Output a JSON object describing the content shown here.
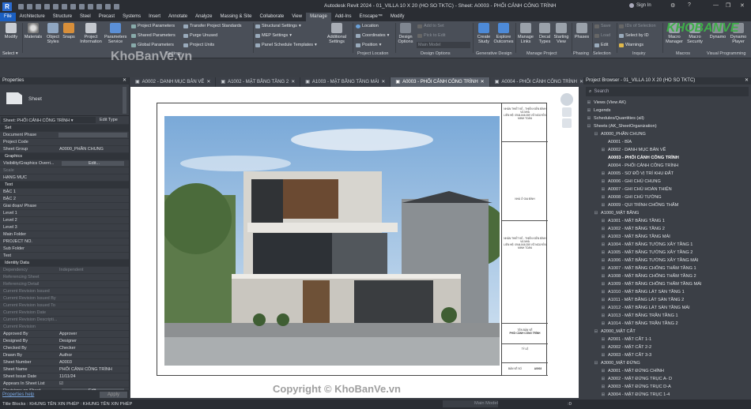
{
  "title": "Autodesk Revit 2024 - 01_VILLA 10 X 20 (HO SO TKTC) - Sheet: A0003 - PHỐI CẢNH CÔNG TRÌNH",
  "sign_in": "Sign In",
  "menu_tabs": [
    "File",
    "Architecture",
    "Structure",
    "Steel",
    "Precast",
    "Systems",
    "Insert",
    "Annotate",
    "Analyze",
    "Massing & Site",
    "Collaborate",
    "View",
    "Manage",
    "Add-Ins",
    "Enscape™",
    "Modify"
  ],
  "ribbon": {
    "modify": "Modify",
    "materials": "Materials",
    "object_styles": "Object Styles",
    "snaps": "Snaps",
    "project_information": "Project Information",
    "parameters_service": "Parameters Service",
    "project_parameters": "Project Parameters",
    "shared_parameters": "Shared Parameters",
    "global_parameters": "Global Parameters",
    "transfer_project_standards": "Transfer Project Standards",
    "purge_unused": "Purge Unused",
    "project_units": "Project Units",
    "structural_settings": "Structural Settings",
    "mep_settings": "MEP Settings",
    "panel_schedule_templates": "Panel Schedule Templates",
    "additional_settings": "Additional Settings",
    "location": "Location",
    "coordinates": "Coordinates",
    "position": "Position",
    "design_options": "Design Options",
    "add_to_set": "Add to Set",
    "pick_to_edit": "Pick to Edit",
    "main_model": "Main Model",
    "create_study": "Create Study",
    "explore_outcomes": "Explore Outcomes",
    "manage_links": "Manage Links",
    "decal_types": "Decal Types",
    "starting_view": "Starting View",
    "phases": "Phases",
    "save": "Save",
    "load": "Load",
    "edit": "Edit",
    "ids_of_selection": "IDs of Selection",
    "select_by_id": "Select by ID",
    "warnings": "Warnings",
    "macro_manager": "Macro Manager",
    "macro_security": "Macro Security",
    "dynamo": "Dynamo",
    "dynamo_player": "Dynamo Player",
    "select_label": "Select ▾",
    "panels": [
      "Settings",
      "Project Location",
      "Design Options",
      "Generative Design",
      "Manage Project",
      "Phasing",
      "Selection",
      "Inquiry",
      "Macros",
      "Visual Programming"
    ]
  },
  "properties": {
    "header": "Properties",
    "type": "Sheet",
    "instance": "Sheet: PHỐI CẢNH CÔNG TRÌNH",
    "edit_type": "Edit Type",
    "rows": [
      {
        "k": "Set",
        "grp": true
      },
      {
        "k": "Document Phase",
        "v": "",
        "box": true
      },
      {
        "k": "Project Code",
        "v": ""
      },
      {
        "k": "Sheet Group",
        "v": "A0000_PHẦN CHUNG"
      },
      {
        "k": "Graphics",
        "grp": true
      },
      {
        "k": "Visibility/Graphics Overri...",
        "v": "Edit...",
        "btn": true
      },
      {
        "k": "Scale",
        "v": "",
        "dim": true
      },
      {
        "k": "HẠNG MỤC",
        "v": ""
      },
      {
        "k": "Text",
        "grp": true
      },
      {
        "k": "BẬC 1",
        "v": ""
      },
      {
        "k": "BẬC 2",
        "v": ""
      },
      {
        "k": "Giai đoạn/ Phase",
        "v": ""
      },
      {
        "k": "Level 1",
        "v": ""
      },
      {
        "k": "Level 2",
        "v": ""
      },
      {
        "k": "Level 3",
        "v": ""
      },
      {
        "k": "Main Folder",
        "v": ""
      },
      {
        "k": "PROJECT NO.",
        "v": ""
      },
      {
        "k": "Sub Folder",
        "v": ""
      },
      {
        "k": "Text",
        "v": ""
      },
      {
        "k": "Identity Data",
        "grp": true
      },
      {
        "k": "Dependency",
        "v": "Independent",
        "dim": true
      },
      {
        "k": "Referencing Sheet",
        "v": "",
        "dim": true
      },
      {
        "k": "Referencing Detail",
        "v": "",
        "dim": true
      },
      {
        "k": "Current Revision Issued",
        "v": "",
        "dim": true
      },
      {
        "k": "Current Revision Issued By",
        "v": "",
        "dim": true
      },
      {
        "k": "Current Revision Issued To",
        "v": "",
        "dim": true
      },
      {
        "k": "Current Revision Date",
        "v": "",
        "dim": true
      },
      {
        "k": "Current Revision Descripti...",
        "v": "",
        "dim": true
      },
      {
        "k": "Current Revision",
        "v": "",
        "dim": true
      },
      {
        "k": "Approved By",
        "v": "Approver"
      },
      {
        "k": "Designed By",
        "v": "Designer"
      },
      {
        "k": "Checked By",
        "v": "Checker"
      },
      {
        "k": "Drawn By",
        "v": "Author"
      },
      {
        "k": "Sheet Number",
        "v": "A0003"
      },
      {
        "k": "Sheet Name",
        "v": "PHỐI CẢNH CÔNG TRÌNH"
      },
      {
        "k": "Sheet Issue Date",
        "v": "11/11/24"
      },
      {
        "k": "Appears In Sheet List",
        "v": "☑"
      },
      {
        "k": "Revisions on Sheet",
        "v": "Edit...",
        "btn": true
      }
    ],
    "help": "Properties help",
    "apply": "Apply"
  },
  "view_tabs": [
    "A0002 - DANH MỤC BẢN VẼ",
    "A1002 - MẶT BẰNG TẦNG 2",
    "A1003 - MẶT BẰNG TẦNG MÁI",
    "A0003 - PHỐI CẢNH CÔNG TRÌNH",
    "A0004 - PHỐI CẢNH CÔNG TRÌNH"
  ],
  "titleblock": {
    "company": "NHÂN THIẾT KẾ - THIẾN KIẾN ĐÌNH VÀ NHÀ",
    "contact": "LIÊN HỆ: 0944.846.359 VÕ NGUYỄN MINH TOÀN",
    "owner": "NHÀ Ở GIA ĐÌNH",
    "designer": "NHÂN THIẾT KẾ - THIẾN KIẾN ĐÌNH VÀ NHÀ",
    "contact2": "LIÊN HỆ: 0944.846.359 VÕ NGUYỄN MINH TOÀN",
    "drawing_label": "TÊN BẢN VẼ",
    "drawing_name": "PHỐI CẢNH CÔNG TRÌNH",
    "ratio": "TỶ LỆ",
    "sheet_label": "BẢN VẼ SỐ",
    "sheet_no": "A0003"
  },
  "browser": {
    "header": "Project Browser - 01_VILLA 10 X 20 (HO SO TKTC)",
    "search": "Search",
    "items": [
      {
        "lvl": 0,
        "t": "⊞",
        "label": "Views (View AK)"
      },
      {
        "lvl": 0,
        "t": "⊞",
        "label": "Legends"
      },
      {
        "lvl": 0,
        "t": "⊞",
        "label": "Schedules/Quantities (all)"
      },
      {
        "lvl": 0,
        "t": "⊟",
        "label": "Sheets (AK_SheetOrganization)"
      },
      {
        "lvl": 1,
        "t": "⊟",
        "label": "A0000_PHẦN CHUNG"
      },
      {
        "lvl": 2,
        "t": "",
        "label": "A0001 - BÌA"
      },
      {
        "lvl": 2,
        "t": "⊞",
        "label": "A0002 - DANH MỤC BẢN VẼ"
      },
      {
        "lvl": 2,
        "t": "",
        "label": "A0003 - PHỐI CẢNH CÔNG TRÌNH",
        "bold": true
      },
      {
        "lvl": 2,
        "t": "",
        "label": "A0004 - PHỐI CẢNH CÔNG TRÌNH"
      },
      {
        "lvl": 2,
        "t": "⊞",
        "label": "A0005 - SƠ ĐỒ VỊ TRÍ KHU ĐẤT"
      },
      {
        "lvl": 2,
        "t": "⊞",
        "label": "A0006 - GHI CHÚ CHUNG"
      },
      {
        "lvl": 2,
        "t": "⊞",
        "label": "A0007 - GHI CHÚ HOÀN THIỆN"
      },
      {
        "lvl": 2,
        "t": "⊞",
        "label": "A0008 - GHI CHÚ TƯỜNG"
      },
      {
        "lvl": 2,
        "t": "⊞",
        "label": "A0009 - QUI TRÌNH CHỐNG THẤM"
      },
      {
        "lvl": 1,
        "t": "⊟",
        "label": "A1000_MẶT BẰNG"
      },
      {
        "lvl": 2,
        "t": "⊞",
        "label": "A1001 - MẶT BẰNG TẦNG 1"
      },
      {
        "lvl": 2,
        "t": "⊞",
        "label": "A1002 - MẶT BẰNG TẦNG 2"
      },
      {
        "lvl": 2,
        "t": "⊞",
        "label": "A1003 - MẶT BẰNG TẦNG MÁI"
      },
      {
        "lvl": 2,
        "t": "⊞",
        "label": "A1004 - MẶT BẰNG TƯỜNG XÂY TẦNG 1"
      },
      {
        "lvl": 2,
        "t": "⊞",
        "label": "A1005 - MẶT BẰNG TƯỜNG XÂY TẦNG 2"
      },
      {
        "lvl": 2,
        "t": "⊞",
        "label": "A1006 - MẶT BẰNG TƯỜNG XÂY TẦNG MÁI"
      },
      {
        "lvl": 2,
        "t": "⊞",
        "label": "A1007 - MẶT BẰNG CHỐNG THẤM TẦNG 1"
      },
      {
        "lvl": 2,
        "t": "⊞",
        "label": "A1008 - MẶT BẰNG CHỐNG THẤM TẦNG 2"
      },
      {
        "lvl": 2,
        "t": "⊞",
        "label": "A1009 - MẶT BẰNG CHỐNG THẤM TẦNG MÁI"
      },
      {
        "lvl": 2,
        "t": "⊞",
        "label": "A1010 - MẶT BẰNG LÁT SÀN TẦNG 1"
      },
      {
        "lvl": 2,
        "t": "⊞",
        "label": "A1011 - MẶT BẰNG LÁT SÀN TẦNG 2"
      },
      {
        "lvl": 2,
        "t": "⊞",
        "label": "A1012 - MẶT BẰNG LÁT SÀN TẦNG MÁI"
      },
      {
        "lvl": 2,
        "t": "⊞",
        "label": "A1013 - MẶT BẰNG TRẦN TẦNG 1"
      },
      {
        "lvl": 2,
        "t": "⊞",
        "label": "A1014 - MẶT BẰNG TRẦN TẦNG 2"
      },
      {
        "lvl": 1,
        "t": "⊟",
        "label": "A2000_MẶT CẮT"
      },
      {
        "lvl": 2,
        "t": "⊞",
        "label": "A2001 - MẶT CẮT 1-1"
      },
      {
        "lvl": 2,
        "t": "⊞",
        "label": "A2002 - MẶT CẮT 2-2"
      },
      {
        "lvl": 2,
        "t": "⊞",
        "label": "A2003 - MẶT CẮT 3-3"
      },
      {
        "lvl": 1,
        "t": "⊟",
        "label": "A3000_MẶT ĐỨNG"
      },
      {
        "lvl": 2,
        "t": "⊞",
        "label": "A3001 - MẶT ĐỨNG CHÍNH"
      },
      {
        "lvl": 2,
        "t": "⊞",
        "label": "A3002 - MẶT ĐỨNG TRỤC A- D"
      },
      {
        "lvl": 2,
        "t": "⊞",
        "label": "A3003 - MẶT ĐỨNG TRỤC D-A"
      },
      {
        "lvl": 2,
        "t": "⊞",
        "label": "A3004 - MẶT ĐỨNG TRỤC 1-4"
      }
    ]
  },
  "status": {
    "left": "Title Blocks : KHUNG TÊN XIN PHÉP : KHUNG TÊN XIN PHÉP",
    "model": "Main Model",
    "zero": ":0"
  },
  "watermarks": {
    "brand": "KhoBanVe.vn",
    "copyright": "Copyright © KhoBanVe.vn",
    "logo": "KHOBANVE"
  },
  "colors": {
    "accent": "#1b5fc1",
    "ribbon": "#4a4f58",
    "panel": "#3b3f46"
  }
}
